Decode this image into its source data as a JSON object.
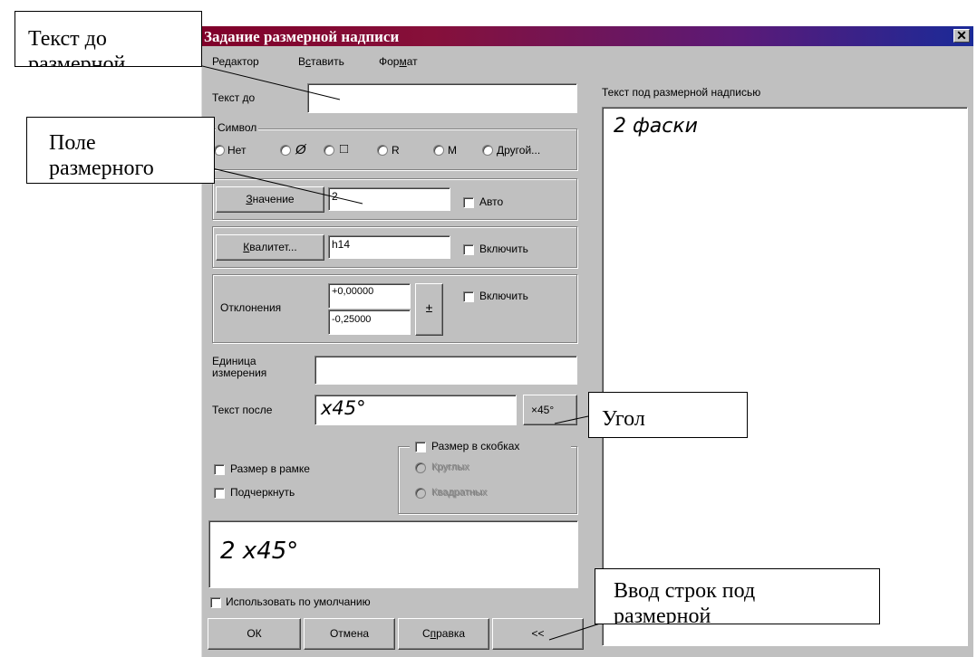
{
  "dialog": {
    "title": "Задание размерной надписи",
    "close_glyph": "✕",
    "menu": [
      {
        "pre": "Ре",
        "acc": "д",
        "post": "актор"
      },
      {
        "pre": "В",
        "acc": "с",
        "post": "тавить"
      },
      {
        "pre": "Фор",
        "acc": "м",
        "post": "ат"
      }
    ]
  },
  "form": {
    "text_before_label": "Текст до",
    "text_before_value": "",
    "symbol": {
      "legend": "Символ",
      "options": [
        "Нет",
        "Ø",
        "□",
        "R",
        "M",
        "Другой..."
      ]
    },
    "value_button": {
      "acc": "З",
      "rest": "начение"
    },
    "value": "2",
    "auto_label": "Авто",
    "quality_button": {
      "acc": "К",
      "rest": "валитет..."
    },
    "quality": "h14",
    "quality_enable_label": "Включить",
    "deviations_label": "Отклонения",
    "deviation_upper": "+0,00000",
    "deviation_lower": "-0,25000",
    "plusminus": "±",
    "deviations_enable_label": "Включить",
    "unit_label_line1": "Единица",
    "unit_label_line2": "измерения",
    "unit_value": "",
    "text_after_label": "Текст после",
    "text_after_value": "x45°",
    "angle_button": "×45°",
    "frame_label": "Размер в рамке",
    "underline_label": "Подчеркнуть",
    "brackets_label": "Размер в скобках",
    "round_label": "Круглых",
    "square_label": "Квадратных",
    "preview": "2 x45°",
    "use_default_label": "Использовать по умолчанию",
    "buttons": {
      "ok": "ОК",
      "cancel": "Отмена",
      "help_pre": "С",
      "help_acc": "п",
      "help_post": "равка",
      "collapse": "<<"
    }
  },
  "right_panel": {
    "label": "Текст под размерной надписью",
    "content": "2 фаски"
  },
  "callouts": {
    "text_before_l1": "Текст до",
    "text_before_l2": "размерной",
    "field_l1": "Поле",
    "field_l2": "размерного",
    "angle": "Угол",
    "lines_below_l1": "Ввод строк под",
    "lines_below_l2": "размерной"
  }
}
